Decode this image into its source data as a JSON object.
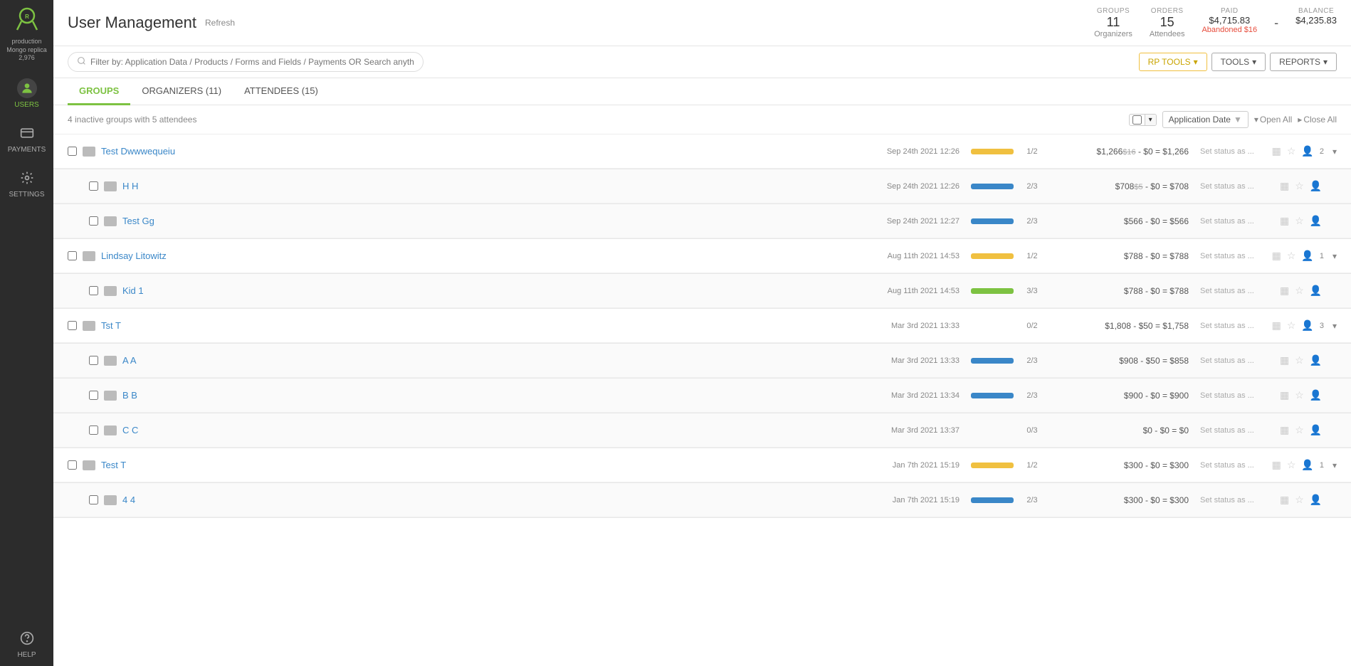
{
  "sidebar": {
    "logo_text": "Regpack",
    "env_line1": "production",
    "env_line2": "Mongo replica",
    "env_line3": "2,976",
    "nav_items": [
      {
        "id": "users",
        "label": "USERS",
        "icon": "👤",
        "active": true
      },
      {
        "id": "payments",
        "label": "PAYMENTS",
        "icon": "💳",
        "active": false
      },
      {
        "id": "settings",
        "label": "SETTINGS",
        "icon": "⚙",
        "active": false
      },
      {
        "id": "help",
        "label": "HELP",
        "icon": "?",
        "active": false
      }
    ]
  },
  "header": {
    "title": "User Management",
    "refresh_label": "Refresh",
    "stats": {
      "groups_label": "GROUPS",
      "groups_value": "11",
      "groups_sub": "Organizers",
      "orders_label": "ORDERS",
      "orders_value": "15",
      "orders_sub": "Attendees",
      "paid_label": "PAID",
      "paid_value": "$4,715.83",
      "paid_abandoned": "Abandoned $16",
      "balance_label": "BALANCE",
      "balance_eq": "=",
      "balance_value": "$4,235.83"
    }
  },
  "toolbar": {
    "search_placeholder": "Filter by: Application Data / Products / Forms and Fields / Payments OR Search anything...",
    "rp_tools_label": "RP TOOLS",
    "tools_label": "TOOLS",
    "reports_label": "REPORTS"
  },
  "tabs": [
    {
      "id": "groups",
      "label": "GROUPS",
      "active": true
    },
    {
      "id": "organizers",
      "label": "ORGANIZERS (11)",
      "active": false
    },
    {
      "id": "attendees",
      "label": "ATTENDEES (15)",
      "active": false
    }
  ],
  "sub_toolbar": {
    "inactive_label": "4 inactive groups with 5 attendees",
    "sort_label": "Application Date",
    "open_all_label": "Open All",
    "close_all_label": "Close All"
  },
  "groups": [
    {
      "id": "g1",
      "name": "Test Dwwwequeiu",
      "date": "Sep 24th 2021 12:26",
      "bar_color": "bar-yellow",
      "ratio": "1/2",
      "paid": "$1,266",
      "paid_strike": "$16",
      "discount": "$0",
      "balance": "$1,266",
      "set_status": "Set status as ...",
      "attendee_count": "2",
      "expandable": true,
      "child": false,
      "has_children": true
    },
    {
      "id": "g1c1",
      "name": "H H",
      "date": "Sep 24th 2021 12:26",
      "bar_color": "bar-blue",
      "ratio": "2/3",
      "paid": "$708",
      "paid_strike": "$5",
      "discount": "$0",
      "balance": "$708",
      "set_status": "Set status as ...",
      "attendee_count": "",
      "expandable": false,
      "child": true,
      "has_children": false
    },
    {
      "id": "g1c2",
      "name": "Test Gg",
      "date": "Sep 24th 2021 12:27",
      "bar_color": "bar-blue",
      "ratio": "2/3",
      "paid": "$566",
      "paid_strike": "",
      "discount": "$0",
      "balance": "$566",
      "set_status": "Set status as ...",
      "attendee_count": "",
      "expandable": false,
      "child": true,
      "has_children": false
    },
    {
      "id": "g2",
      "name": "Lindsay Litowitz",
      "date": "Aug 11th 2021 14:53",
      "bar_color": "bar-yellow",
      "ratio": "1/2",
      "paid": "$788",
      "paid_strike": "",
      "discount": "$0",
      "balance": "$788",
      "set_status": "Set status as ...",
      "attendee_count": "1",
      "expandable": true,
      "child": false,
      "has_children": true
    },
    {
      "id": "g2c1",
      "name": "Kid 1",
      "date": "Aug 11th 2021 14:53",
      "bar_color": "bar-green",
      "ratio": "3/3",
      "paid": "$788",
      "paid_strike": "",
      "discount": "$0",
      "balance": "$788",
      "set_status": "Set status as ...",
      "attendee_count": "",
      "expandable": false,
      "child": true,
      "has_children": false
    },
    {
      "id": "g3",
      "name": "Tst T",
      "date": "Mar 3rd 2021 13:33",
      "bar_color": "",
      "ratio": "0/2",
      "paid": "$1,808",
      "paid_strike": "",
      "discount": "$50",
      "balance": "$1,758",
      "set_status": "Set status as ...",
      "attendee_count": "3",
      "expandable": true,
      "child": false,
      "has_children": true
    },
    {
      "id": "g3c1",
      "name": "A A",
      "date": "Mar 3rd 2021 13:33",
      "bar_color": "bar-blue",
      "ratio": "2/3",
      "paid": "$908",
      "paid_strike": "",
      "discount": "$50",
      "balance": "$858",
      "set_status": "Set status as ...",
      "attendee_count": "",
      "expandable": false,
      "child": true,
      "has_children": false
    },
    {
      "id": "g3c2",
      "name": "B B",
      "date": "Mar 3rd 2021 13:34",
      "bar_color": "bar-blue",
      "ratio": "2/3",
      "paid": "$900",
      "paid_strike": "",
      "discount": "$0",
      "balance": "$900",
      "set_status": "Set status as ...",
      "attendee_count": "",
      "expandable": false,
      "child": true,
      "has_children": false
    },
    {
      "id": "g3c3",
      "name": "C C",
      "date": "Mar 3rd 2021 13:37",
      "bar_color": "",
      "ratio": "0/3",
      "paid": "$0",
      "paid_strike": "",
      "discount": "$0",
      "balance": "$0",
      "set_status": "Set status as ...",
      "attendee_count": "",
      "expandable": false,
      "child": true,
      "has_children": false
    },
    {
      "id": "g4",
      "name": "Test T",
      "date": "Jan 7th 2021 15:19",
      "bar_color": "bar-yellow",
      "ratio": "1/2",
      "paid": "$300",
      "paid_strike": "",
      "discount": "$0",
      "balance": "$300",
      "set_status": "Set status as ...",
      "attendee_count": "1",
      "expandable": true,
      "child": false,
      "has_children": true
    },
    {
      "id": "g4c1",
      "name": "4 4",
      "date": "Jan 7th 2021 15:19",
      "bar_color": "bar-blue",
      "ratio": "2/3",
      "paid": "$300",
      "paid_strike": "",
      "discount": "$0",
      "balance": "$300",
      "set_status": "Set status as ...",
      "attendee_count": "",
      "expandable": false,
      "child": true,
      "has_children": false
    }
  ]
}
